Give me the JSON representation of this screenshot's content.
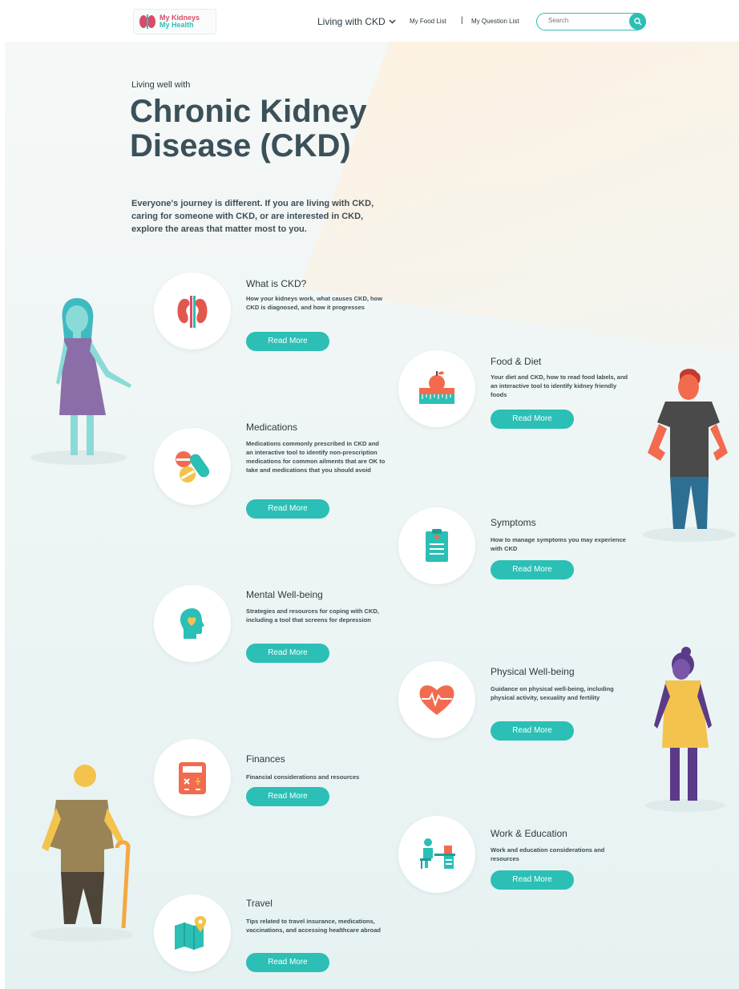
{
  "header": {
    "logo": {
      "line1": "My Kidneys",
      "line2": "My Health"
    },
    "nav": {
      "living": "Living with CKD",
      "food_list": "My Food List",
      "separator": "|",
      "question_list": "My Question List"
    },
    "search": {
      "placeholder": "Search"
    }
  },
  "hero": {
    "subtitle": "Living well with",
    "title": "Chronic Kidney Disease (CKD)",
    "intro": "Everyone's journey is different. If you are living with CKD, caring for someone with CKD, or are interested in CKD, explore the areas that matter most to you."
  },
  "topics": [
    {
      "title": "What is CKD?",
      "desc": "How your kidneys work, what causes CKD, how CKD is diagnosed, and how it progresses",
      "button": "Read More",
      "icon": "kidney-icon"
    },
    {
      "title": "Food & Diet",
      "desc": "Your diet and CKD, how to read food labels, and an interactive tool to identify kidney friendly foods",
      "button": "Read More",
      "icon": "food-scale-icon"
    },
    {
      "title": "Medications",
      "desc": "Medications commonly prescribed in CKD and an interactive tool to identify non-prescription medications for common ailments that are OK to take and medications that you should avoid",
      "button": "Read More",
      "icon": "pills-icon"
    },
    {
      "title": "Symptoms",
      "desc": "How to manage symptoms you may experience with CKD",
      "button": "Read More",
      "icon": "clipboard-icon"
    },
    {
      "title": "Mental Well-being",
      "desc": "Strategies and resources for coping with CKD, including a tool that screens for depression",
      "button": "Read More",
      "icon": "head-heart-icon"
    },
    {
      "title": "Physical Well-being",
      "desc": "Guidance on physical well-being, including physical activity, sexuality and fertility",
      "button": "Read More",
      "icon": "heart-pulse-icon"
    },
    {
      "title": "Finances",
      "desc": "Financial considerations and resources",
      "button": "Read More",
      "icon": "calculator-icon"
    },
    {
      "title": "Work & Education",
      "desc": "Work and education considerations and resources",
      "button": "Read More",
      "icon": "desk-icon"
    },
    {
      "title": "Travel",
      "desc": "Tips related to travel insurance, medications, vaccinations, and accessing healthcare abroad",
      "button": "Read More",
      "icon": "map-pin-icon"
    }
  ],
  "colors": {
    "accent": "#2bbfb5",
    "title": "#3b5058",
    "icon_orange": "#f26b4f",
    "icon_teal": "#2bbfb5"
  }
}
